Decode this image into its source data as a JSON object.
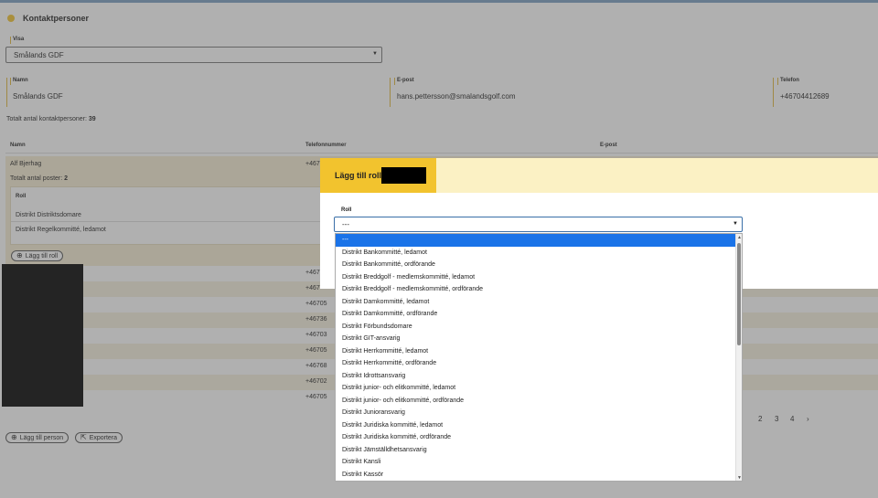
{
  "page": {
    "title": "Kontaktpersoner"
  },
  "filter": {
    "label": "Visa",
    "value": "Smålands GDF"
  },
  "details": {
    "name_label": "Namn",
    "name": "Smålands GDF",
    "email_label": "E-post",
    "email": "hans.pettersson@smalandsgolf.com",
    "phone_label": "Telefon",
    "phone": "+46704412689"
  },
  "summary": {
    "label": "Totalt antal kontaktpersoner:",
    "count": "39"
  },
  "table": {
    "columns": [
      "Namn",
      "Telefonnummer",
      "E-post"
    ],
    "expanded": {
      "name": "Alf Bjerhag",
      "phone": "+467",
      "posts_label": "Totalt antal poster:",
      "posts_count": "2",
      "roles_label": "Roll",
      "roles": [
        "Distrikt Distriktsdomare",
        "Distrikt Regelkommitté, ledamot"
      ],
      "add_role_label": "Lägg till roll"
    },
    "rows": [
      "+467",
      "+467",
      "+46705",
      "+46736",
      "+46703",
      "+46705",
      "+46768",
      "+46702",
      "+46705"
    ]
  },
  "pagination": [
    "2",
    "3",
    "4",
    "›"
  ],
  "footer": {
    "add_person": "Lägg till person",
    "export": "Exportera"
  },
  "modal": {
    "title": "Lägg till roll:",
    "field_label": "Roll",
    "selected": "---",
    "options": [
      "---",
      "Distrikt Bankommitté, ledamot",
      "Distrikt Bankommitté, ordförande",
      "Distrikt Breddgolf - medlemskommitté, ledamot",
      "Distrikt Breddgolf - medlemskommitté, ordförande",
      "Distrikt Damkommitté, ledamot",
      "Distrikt Damkommitté, ordförande",
      "Distrikt Förbundsdomare",
      "Distrikt GIT-ansvarig",
      "Distrikt Herrkommitté, ledamot",
      "Distrikt Herrkommitté, ordförande",
      "Distrikt Idrottsansvarig",
      "Distrikt junior- och elitkommitté, ledamot",
      "Distrikt junior- och elitkommitté, ordförande",
      "Distrikt Junioransvarig",
      "Distrikt Juridiska kommitté, ledamot",
      "Distrikt Juridiska kommitté, ordförande",
      "Distrikt Jämställdhetsansvarig",
      "Distrikt Kansli",
      "Distrikt Kassör"
    ]
  },
  "colors": {
    "accent": "#f2c32e",
    "selection": "#1a73e8",
    "highlight_row": "#f6edd4"
  }
}
